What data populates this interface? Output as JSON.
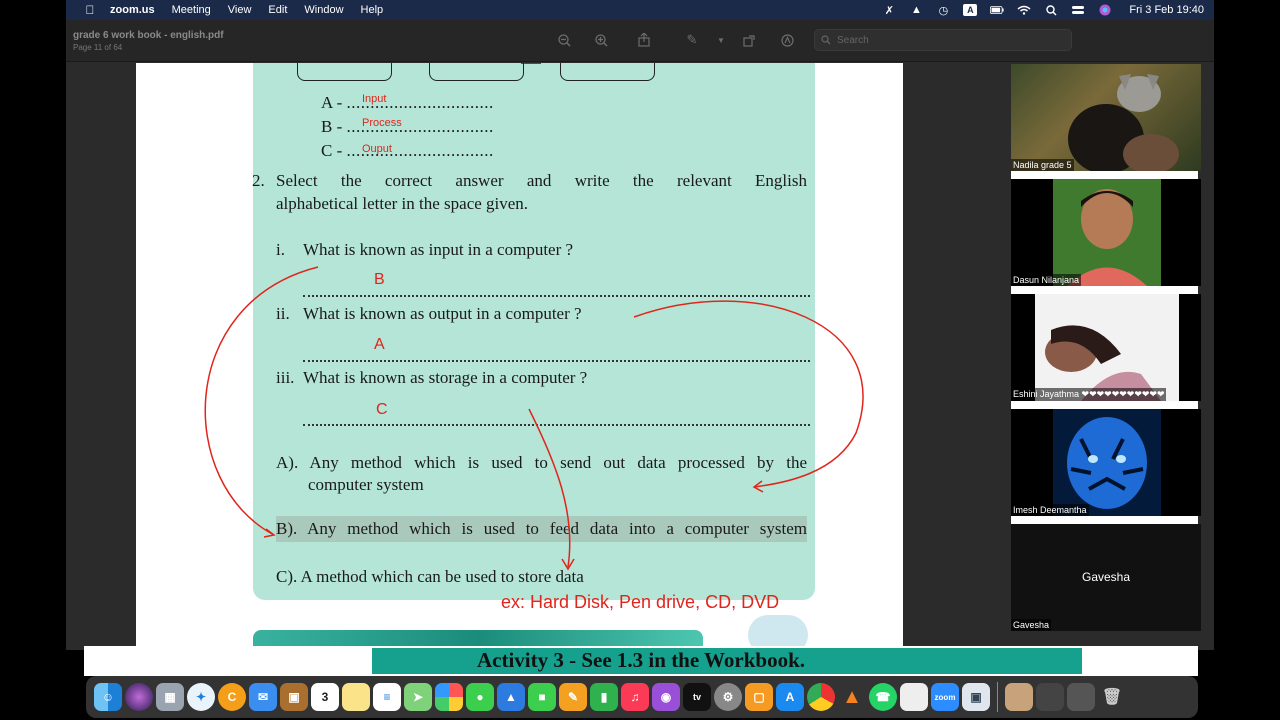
{
  "menubar": {
    "app": "zoom.us",
    "menus": [
      "Meeting",
      "View",
      "Edit",
      "Window",
      "Help"
    ],
    "datetime": "Fri 3 Feb  19:40"
  },
  "preview": {
    "title": "grade 6 work book - english.pdf",
    "page_info": "Page 11 of 64",
    "search_placeholder": "Search"
  },
  "document": {
    "abc_lines": [
      {
        "letter": "A -",
        "answer": "Input"
      },
      {
        "letter": "B -",
        "answer": "Process"
      },
      {
        "letter": "C -",
        "answer": "Ouput"
      }
    ],
    "dots": "...............................",
    "q2_number": "2.",
    "q2_line1": "Select the correct answer and write the relevant English",
    "q2_line2": "alphabetical letter in the space given.",
    "questions": [
      {
        "num": "i.",
        "text": "What is known as input in a computer ?",
        "answer": "B"
      },
      {
        "num": "ii.",
        "text": "What is known as output in a computer ?",
        "answer": "A"
      },
      {
        "num": "iii.",
        "text": "What is known as storage in a computer ?",
        "answer": "C"
      }
    ],
    "options": {
      "a_line1": "A). Any method which is used to send out data processed by the",
      "a_line2": "computer system",
      "b": "B). Any method which is used to feed data into a computer system",
      "c": "C). A method which can be used to store data"
    },
    "example_note": "ex: Hard Disk, Pen drive, CD, DVD"
  },
  "participants": [
    {
      "name": "Nadila grade 5"
    },
    {
      "name": "Dasun Nilanjana"
    },
    {
      "name": "Eshini Jayathma ❤❤❤❤❤❤❤❤❤❤❤"
    },
    {
      "name": "Imesh Deemantha"
    },
    {
      "name": "Gavesha",
      "center_label": "Gavesha"
    }
  ],
  "activity_banner": "Activity 3 - See 1.3 in the Workbook.",
  "dock": {
    "calendar_day": "3",
    "mail_badge": "",
    "appstore_badge": "",
    "apps": [
      "finder",
      "siri",
      "launchpad",
      "safari",
      "chrome-c",
      "mail",
      "package",
      "calendar",
      "notes",
      "reminders",
      "maps",
      "photos",
      "messages",
      "keynote",
      "facetime",
      "pages",
      "numbers",
      "music",
      "podcasts",
      "tv",
      "settings",
      "books",
      "appstore",
      "chrome",
      "vlc",
      "whatsapp",
      "blank",
      "zoom",
      "preview"
    ]
  }
}
